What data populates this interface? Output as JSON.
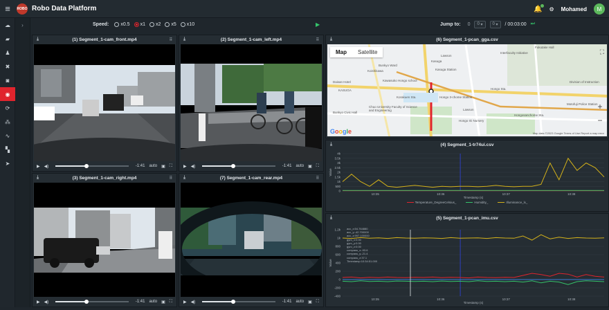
{
  "app": {
    "title": "Robo Data Platform",
    "logo_text": "ROBO",
    "user_name": "Mohamed",
    "user_initial": "M"
  },
  "sidebar": {
    "items": [
      {
        "icon": "cloud-icon"
      },
      {
        "icon": "folder-icon"
      },
      {
        "icon": "user-icon"
      },
      {
        "icon": "tools-icon"
      },
      {
        "icon": "robot-icon"
      },
      {
        "icon": "eye-icon",
        "active": true
      },
      {
        "icon": "settings-icon"
      },
      {
        "icon": "network-icon"
      },
      {
        "icon": "signal-icon"
      },
      {
        "icon": "chat-icon"
      },
      {
        "icon": "pointer-icon"
      }
    ]
  },
  "controls": {
    "speed_label": "Speed:",
    "speed_options": [
      "x0.5",
      "x1",
      "x2",
      "x5",
      "x10"
    ],
    "speed_selected": "x1",
    "jump_label": "Jump to:",
    "jump_hour": "0",
    "jump_min": "0",
    "jump_sec": "0",
    "time_total": "/ 00:03:00"
  },
  "panels": {
    "front": {
      "title": "(1) Segment_1-cam_front.mp4",
      "time": "-1:41",
      "auto": "auto",
      "progress": 0.42
    },
    "left": {
      "title": "(2) Segment_1-cam_left.mp4",
      "time": "-1:41",
      "auto": "auto",
      "progress": 0.42
    },
    "right": {
      "title": "(3) Segment_1-cam_right.mp4",
      "time": "-1:41",
      "auto": "auto",
      "progress": 0.42
    },
    "rear": {
      "title": "(7) Segment_1-cam_rear.mp4",
      "time": "-1:41",
      "auto": "auto",
      "progress": 0.42
    },
    "map": {
      "title": "(6) Segment_1-pcan_gga.csv",
      "tab_map": "Map",
      "tab_satellite": "Satellite",
      "google": "Google",
      "attribution": "Map data ©2023 Google   Terms of Use   Report a map error",
      "labels": [
        "Fukutake Hall",
        "Interfaculty Initiative",
        "Kasuga",
        "Kasuga Station",
        "Lawson",
        "Bunkyo Ward",
        "Koishikawa",
        "Kawasuko Hongo school",
        "Daisan Hotel",
        "Korakuen Sta.",
        "Hongo 3-chome Station",
        "KASUGA",
        "Hongo Sta.",
        "Chuo University Faculty of Science and Engineering",
        "Bunkyo Civic Hall",
        "Division of Instruction",
        "Motofuji Police Station",
        "Hongo IG Nursery",
        "Lawson",
        "Hongosanchome Sta."
      ]
    },
    "env": {
      "title": "(4) Segment_1-tr74ui.csv",
      "ylabel": "Value",
      "xlabel": "Timestamp (s)",
      "yticks": [
        "4k",
        "3.5k",
        "3k",
        "2.5k",
        "2k",
        "1.5k",
        "1k",
        "500",
        "0"
      ],
      "xticks": [
        "10:35",
        "10:36",
        "10:37",
        "10:38"
      ],
      "legend": [
        "Temperature_DegreeCelsius_",
        "Humidity_",
        "Illuminance_lx_"
      ]
    },
    "imu": {
      "title": "(5) Segment_1-pcan_imu.csv",
      "ylabel": "Value",
      "xlabel": "Timestamp (s)",
      "yticks": [
        "1.2k",
        "1k",
        "800",
        "600",
        "400",
        "200",
        "0",
        "-200",
        "-400"
      ],
      "xticks": [
        "10:35",
        "10:36",
        "10:37",
        "10:38"
      ],
      "readout": [
        "acc_x:54.764880",
        "acc_y:-42.700000",
        "acc_z:997.100000",
        "gyro_x:0.00",
        "gyro_y:0.00",
        "gyro_z:0.00",
        "compass_x:-93.6",
        "compass_y:-21.4",
        "compass_z:37.1",
        "Timestamp:10:34:51.000"
      ]
    }
  },
  "chart_data": [
    {
      "type": "line",
      "title": "(4) Segment_1-tr74ui.csv",
      "xlabel": "Timestamp (s)",
      "ylabel": "Value",
      "ylim": [
        0,
        4000
      ],
      "x_ticks": [
        "10:35",
        "10:36",
        "10:37",
        "10:38"
      ],
      "series": [
        {
          "name": "Temperature_DegreeCelsius_",
          "color": "#e0242d",
          "values": [
            30,
            30,
            30,
            30,
            30,
            30,
            30,
            30,
            30,
            30,
            30,
            30,
            30,
            30,
            30,
            30,
            30,
            30,
            30,
            30,
            30,
            30,
            30,
            30,
            30,
            30,
            30,
            30,
            30,
            30
          ]
        },
        {
          "name": "Humidity_",
          "color": "#35c46b",
          "values": [
            60,
            60,
            60,
            60,
            60,
            60,
            60,
            60,
            60,
            60,
            60,
            60,
            60,
            60,
            60,
            60,
            60,
            60,
            60,
            60,
            60,
            60,
            60,
            60,
            60,
            60,
            60,
            60,
            60,
            60
          ]
        },
        {
          "name": "Illuminance_lx_",
          "color": "#d4b21a",
          "values": [
            1000,
            1800,
            1000,
            500,
            1200,
            500,
            400,
            500,
            600,
            500,
            400,
            500,
            450,
            500,
            500,
            450,
            500,
            600,
            500,
            450,
            500,
            500,
            700,
            3000,
            1200,
            3500,
            2200,
            3000,
            2500,
            1500
          ]
        }
      ]
    },
    {
      "type": "line",
      "title": "(5) Segment_1-pcan_imu.csv",
      "xlabel": "Timestamp (s)",
      "ylabel": "Value",
      "ylim": [
        -400,
        1200
      ],
      "x_ticks": [
        "10:35",
        "10:36",
        "10:37",
        "10:38"
      ],
      "series": [
        {
          "name": "acc_z",
          "color": "#d4b21a",
          "values": [
            1000,
            990,
            1010,
            995,
            1005,
            990,
            1010,
            1000,
            995,
            1005,
            1000,
            990,
            1010,
            995,
            1000,
            1005,
            990,
            1010,
            1000,
            995,
            1050,
            950,
            1080,
            980,
            1020,
            990,
            1010,
            1000,
            995,
            1005
          ]
        },
        {
          "name": "acc_x",
          "color": "#e0242d",
          "values": [
            50,
            60,
            40,
            55,
            45,
            60,
            50,
            45,
            55,
            50,
            60,
            45,
            55,
            50,
            40,
            60,
            50,
            45,
            55,
            50,
            100,
            150,
            120,
            80,
            150,
            130,
            60,
            120,
            80,
            60
          ]
        },
        {
          "name": "acc_y",
          "color": "#35c46b",
          "values": [
            -40,
            -50,
            -30,
            -45,
            -40,
            -50,
            -35,
            -40,
            -45,
            -40,
            -50,
            -35,
            -45,
            -40,
            -50,
            -30,
            -45,
            -40,
            -50,
            -40,
            -60,
            -30,
            -80,
            -40,
            -60,
            -120,
            -50,
            -30,
            -40,
            -50
          ]
        },
        {
          "name": "gyro",
          "color": "#3a7bd5",
          "values": [
            0,
            0,
            0,
            0,
            0,
            0,
            0,
            0,
            0,
            0,
            0,
            0,
            0,
            0,
            0,
            0,
            0,
            0,
            0,
            0,
            0,
            0,
            0,
            0,
            0,
            0,
            0,
            0,
            0,
            0
          ]
        }
      ]
    }
  ]
}
